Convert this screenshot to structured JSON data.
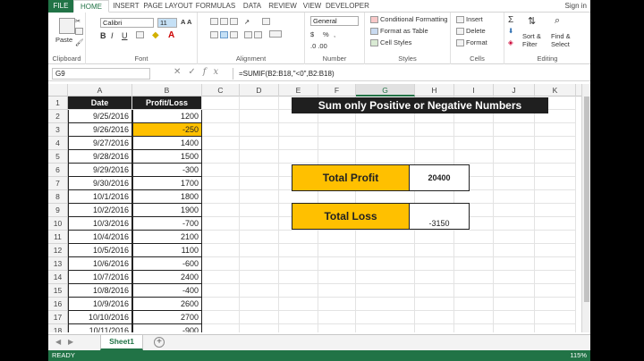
{
  "ribbon_tabs": [
    "FILE",
    "HOME",
    "INSERT",
    "PAGE LAYOUT",
    "FORMULAS",
    "DATA",
    "REVIEW",
    "VIEW",
    "DEVELOPER"
  ],
  "signin": "Sign in",
  "clipboard": {
    "paste": "Paste",
    "label": "Clipboard"
  },
  "font": {
    "name": "Calibri",
    "size": "11",
    "label": "Font"
  },
  "alignment": {
    "label": "Alignment"
  },
  "number": {
    "format": "General",
    "currency": "$",
    "percent": "%",
    "comma": ",",
    "label": "Number"
  },
  "styles": {
    "cond": "Conditional Formatting",
    "table": "Format as Table",
    "cell": "Cell Styles",
    "label": "Styles"
  },
  "cells": {
    "insert": "Insert",
    "delete": "Delete",
    "format": "Format",
    "label": "Cells"
  },
  "editing": {
    "sort": "Sort &",
    "sort2": "Filter",
    "find": "Find &",
    "find2": "Select",
    "label": "Editing"
  },
  "namebox": "G9",
  "fx": "fx",
  "formula": "=SUMIF(B2:B18,\"<0\",B2:B18)",
  "columns": [
    "A",
    "B",
    "C",
    "D",
    "E",
    "F",
    "G",
    "H",
    "I",
    "J",
    "K"
  ],
  "rows": [
    "1",
    "2",
    "3",
    "4",
    "5",
    "6",
    "7",
    "8",
    "9",
    "10",
    "11",
    "12",
    "13",
    "14",
    "15",
    "16",
    "17",
    "18"
  ],
  "table_header": {
    "date": "Date",
    "pl": "Profit/Loss"
  },
  "table_rows": [
    {
      "date": "9/25/2016",
      "value": "1200",
      "neg": false
    },
    {
      "date": "9/26/2016",
      "value": "-250",
      "neg": true
    },
    {
      "date": "9/27/2016",
      "value": "1400",
      "neg": false
    },
    {
      "date": "9/28/2016",
      "value": "1500",
      "neg": false
    },
    {
      "date": "9/29/2016",
      "value": "-300",
      "neg": false
    },
    {
      "date": "9/30/2016",
      "value": "1700",
      "neg": false
    },
    {
      "date": "10/1/2016",
      "value": "1800",
      "neg": false
    },
    {
      "date": "10/2/2016",
      "value": "1900",
      "neg": false
    },
    {
      "date": "10/3/2016",
      "value": "-700",
      "neg": false
    },
    {
      "date": "10/4/2016",
      "value": "2100",
      "neg": false
    },
    {
      "date": "10/5/2016",
      "value": "1100",
      "neg": false
    },
    {
      "date": "10/6/2016",
      "value": "-600",
      "neg": false
    },
    {
      "date": "10/7/2016",
      "value": "2400",
      "neg": false
    },
    {
      "date": "10/8/2016",
      "value": "-400",
      "neg": false
    },
    {
      "date": "10/9/2016",
      "value": "2600",
      "neg": false
    },
    {
      "date": "10/10/2016",
      "value": "2700",
      "neg": false
    },
    {
      "date": "10/11/2016",
      "value": "-900",
      "neg": false
    }
  ],
  "banner": "Sum only Positive or Negative Numbers",
  "total_profit": {
    "label": "Total Profit",
    "value": "20400"
  },
  "total_loss": {
    "label": "Total Loss",
    "value": "-3150"
  },
  "sheet_tab": "Sheet1",
  "add_sheet": "+",
  "status_ready": "READY",
  "zoom": "115%",
  "colors": {
    "excel_green": "#217346",
    "highlight": "#ffc000",
    "header_dark": "#1f1f1f"
  }
}
